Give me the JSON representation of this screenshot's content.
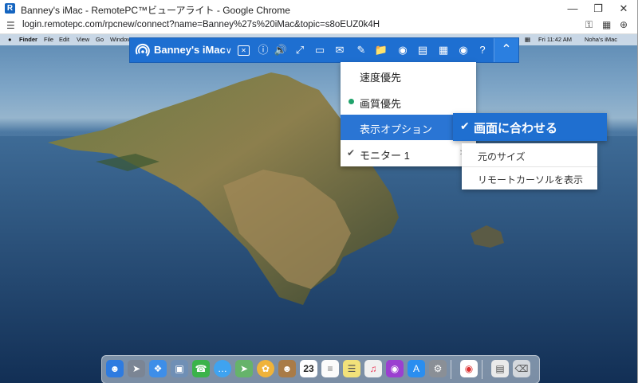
{
  "window": {
    "title": "Banney's iMac - RemotePC™ビューアライト - Google Chrome",
    "icon_letter": "R",
    "minimize_icon": "minimize-icon",
    "restore_icon": "restore-icon",
    "close_icon": "close-icon"
  },
  "address_bar": {
    "url": "login.remotepc.com/rpcnew/connect?name=Banney%27s%20iMac&topic=s8oEUZ0k4H",
    "icons": [
      "site-settings-icon",
      "password-key-icon",
      "translate-icon",
      "zoom-icon"
    ]
  },
  "mac_menubar": {
    "apple": "",
    "items": [
      "Finder",
      "File",
      "Edit",
      "View",
      "Go",
      "Window"
    ],
    "clock": "Fri 11:42 AM",
    "user": "Noha's iMac"
  },
  "remote_toolbar": {
    "device_name": "Banney's iMac",
    "chevron": "∨",
    "icons": [
      "disconnect-icon",
      "info-icon",
      "sound-icon",
      "fullscreen-icon",
      "chat-icon",
      "message-icon",
      "draw-icon",
      "file-transfer-icon",
      "screenshot-icon",
      "notes-icon",
      "multi-monitor-icon",
      "view-options-icon",
      "help-icon"
    ],
    "collapse_icon": "collapse-up-icon"
  },
  "view_menu": {
    "items": [
      {
        "label": "速度優先",
        "marker": ""
      },
      {
        "label": "画質優先",
        "marker": "dot"
      },
      {
        "label": "表示オプション",
        "marker": "",
        "arrow": ">"
      },
      {
        "label": "モニター 1",
        "marker": "check",
        "arrow": ">"
      }
    ]
  },
  "display_submenu": {
    "selected": "画面に合わせる",
    "check": "✔",
    "items": [
      "元のサイズ",
      "リモートカーソルを表示"
    ]
  },
  "dock": {
    "apps": [
      "finder-icon",
      "launchpad-icon",
      "safari-icon",
      "preview-icon",
      "facetime-icon",
      "messages-icon",
      "maps-icon",
      "photos-icon",
      "contacts-icon",
      "calendar-icon",
      "notes-icon",
      "reminders-icon",
      "music-icon",
      "podcasts-icon",
      "app-store-icon",
      "system-preferences-icon",
      "chrome-icon",
      "document-icon",
      "trash-icon"
    ],
    "calendar_day": "23"
  }
}
